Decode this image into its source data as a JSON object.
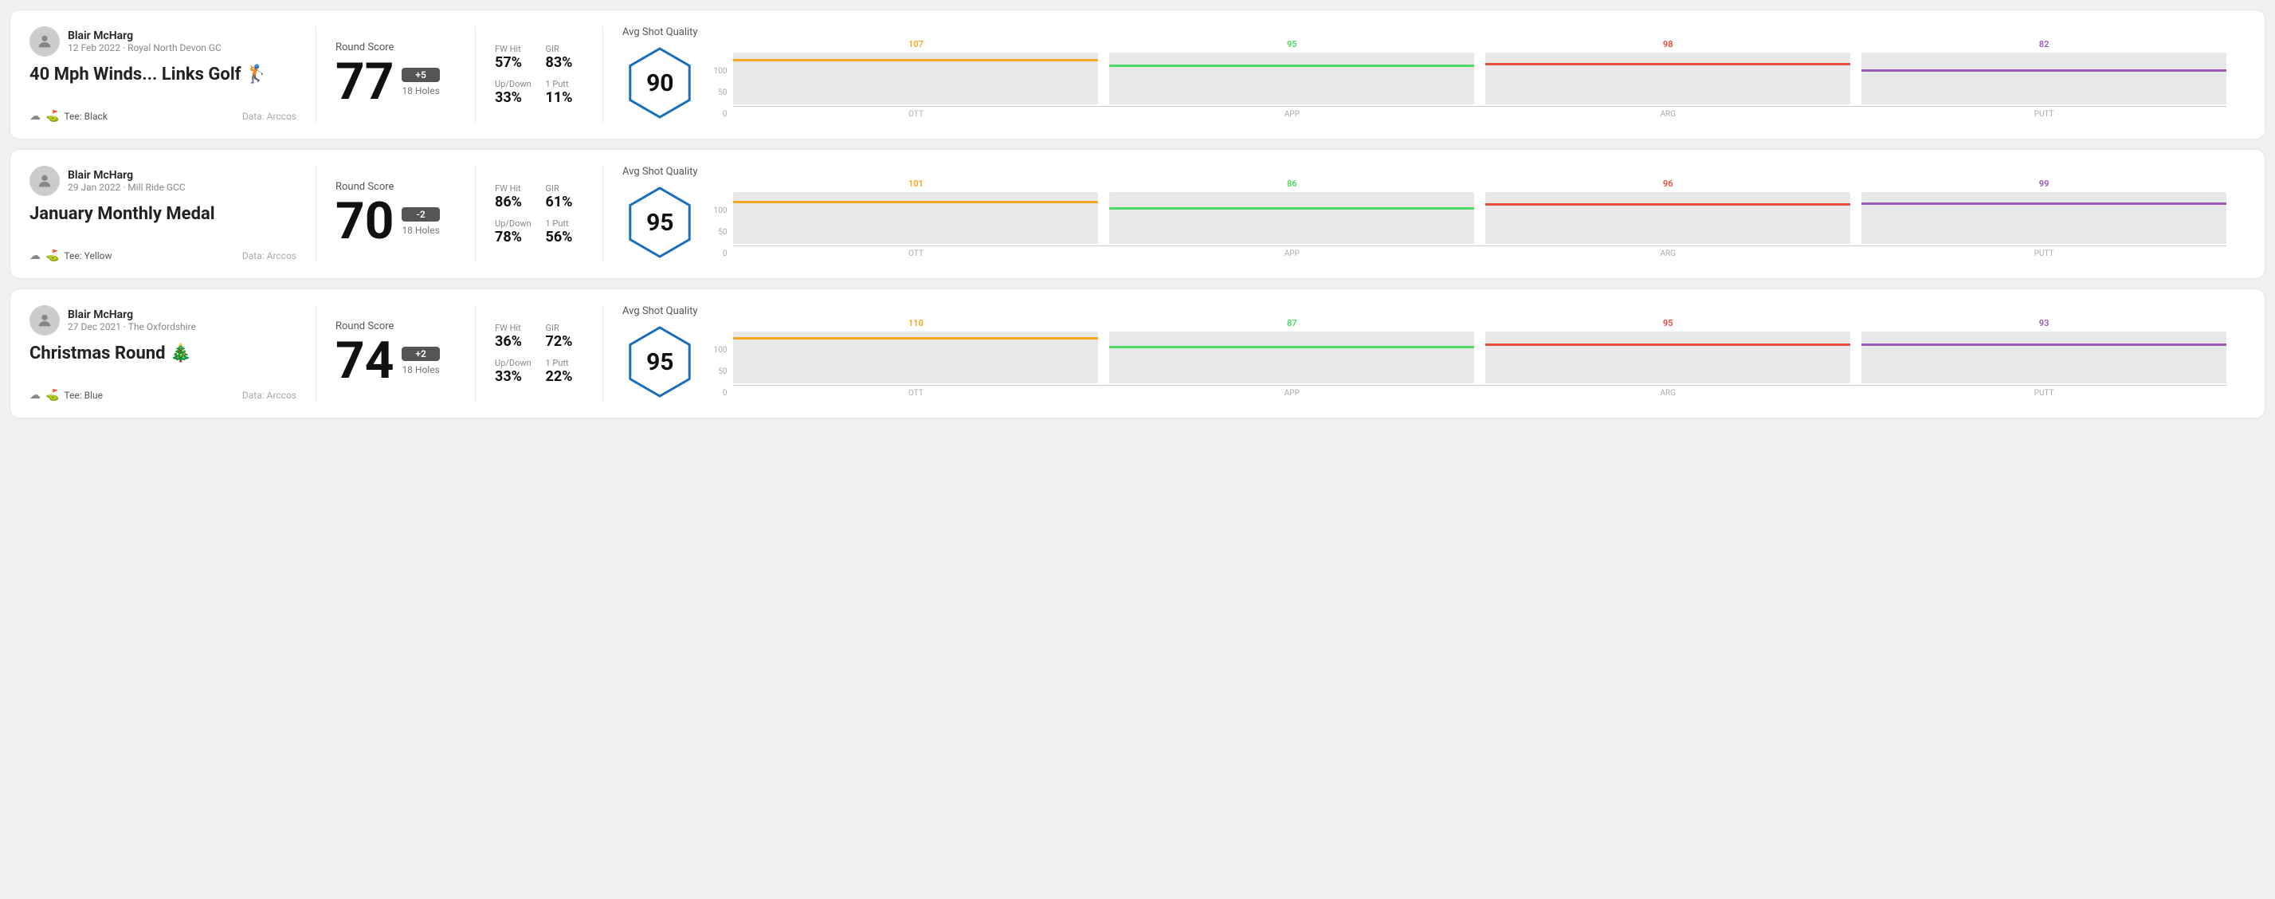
{
  "rounds": [
    {
      "id": "round1",
      "user": {
        "name": "Blair McHarg",
        "date": "12 Feb 2022 · Royal North Devon GC"
      },
      "title": "40 Mph Winds... Links Golf 🏌️",
      "tee": "Black",
      "data_source": "Data: Arccos",
      "score": {
        "value": "77",
        "diff": "+5",
        "holes": "18 Holes",
        "label": "Round Score"
      },
      "stats": {
        "fw_hit_label": "FW Hit",
        "fw_hit": "57%",
        "gir_label": "GIR",
        "gir": "83%",
        "updown_label": "Up/Down",
        "updown": "33%",
        "oneputt_label": "1 Putt",
        "oneputt": "11%"
      },
      "quality": {
        "label": "Avg Shot Quality",
        "score": "90"
      },
      "chart": {
        "ott": {
          "value": 107,
          "color": "#f5a623",
          "max": 130
        },
        "app": {
          "value": 95,
          "color": "#4cd964",
          "max": 130
        },
        "arg": {
          "value": 98,
          "color": "#e74c3c",
          "max": 130
        },
        "putt": {
          "value": 82,
          "color": "#9b59b6",
          "max": 130
        }
      }
    },
    {
      "id": "round2",
      "user": {
        "name": "Blair McHarg",
        "date": "29 Jan 2022 · Mill Ride GCC"
      },
      "title": "January Monthly Medal",
      "tee": "Yellow",
      "data_source": "Data: Arccos",
      "score": {
        "value": "70",
        "diff": "-2",
        "holes": "18 Holes",
        "label": "Round Score"
      },
      "stats": {
        "fw_hit_label": "FW Hit",
        "fw_hit": "86%",
        "gir_label": "GIR",
        "gir": "61%",
        "updown_label": "Up/Down",
        "updown": "78%",
        "oneputt_label": "1 Putt",
        "oneputt": "56%"
      },
      "quality": {
        "label": "Avg Shot Quality",
        "score": "95"
      },
      "chart": {
        "ott": {
          "value": 101,
          "color": "#f5a623",
          "max": 130
        },
        "app": {
          "value": 86,
          "color": "#4cd964",
          "max": 130
        },
        "arg": {
          "value": 96,
          "color": "#e74c3c",
          "max": 130
        },
        "putt": {
          "value": 99,
          "color": "#9b59b6",
          "max": 130
        }
      }
    },
    {
      "id": "round3",
      "user": {
        "name": "Blair McHarg",
        "date": "27 Dec 2021 · The Oxfordshire"
      },
      "title": "Christmas Round 🎄",
      "tee": "Blue",
      "data_source": "Data: Arccos",
      "score": {
        "value": "74",
        "diff": "+2",
        "holes": "18 Holes",
        "label": "Round Score"
      },
      "stats": {
        "fw_hit_label": "FW Hit",
        "fw_hit": "36%",
        "gir_label": "GIR",
        "gir": "72%",
        "updown_label": "Up/Down",
        "updown": "33%",
        "oneputt_label": "1 Putt",
        "oneputt": "22%"
      },
      "quality": {
        "label": "Avg Shot Quality",
        "score": "95"
      },
      "chart": {
        "ott": {
          "value": 110,
          "color": "#f5a623",
          "max": 130
        },
        "app": {
          "value": 87,
          "color": "#4cd964",
          "max": 130
        },
        "arg": {
          "value": 95,
          "color": "#e74c3c",
          "max": 130
        },
        "putt": {
          "value": 93,
          "color": "#9b59b6",
          "max": 130
        }
      }
    }
  ],
  "chart_axis": {
    "y_labels": [
      "100",
      "50",
      "0"
    ],
    "x_labels": [
      "OTT",
      "APP",
      "ARG",
      "PUTT"
    ]
  }
}
